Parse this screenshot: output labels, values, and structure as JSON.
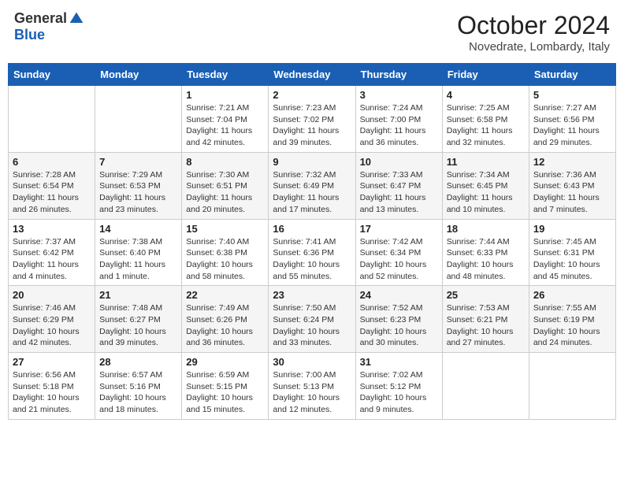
{
  "header": {
    "logo_general": "General",
    "logo_blue": "Blue",
    "month_title": "October 2024",
    "location": "Novedrate, Lombardy, Italy"
  },
  "columns": [
    "Sunday",
    "Monday",
    "Tuesday",
    "Wednesday",
    "Thursday",
    "Friday",
    "Saturday"
  ],
  "weeks": [
    [
      {
        "day": "",
        "sunrise": "",
        "sunset": "",
        "daylight": ""
      },
      {
        "day": "",
        "sunrise": "",
        "sunset": "",
        "daylight": ""
      },
      {
        "day": "1",
        "sunrise": "Sunrise: 7:21 AM",
        "sunset": "Sunset: 7:04 PM",
        "daylight": "Daylight: 11 hours and 42 minutes."
      },
      {
        "day": "2",
        "sunrise": "Sunrise: 7:23 AM",
        "sunset": "Sunset: 7:02 PM",
        "daylight": "Daylight: 11 hours and 39 minutes."
      },
      {
        "day": "3",
        "sunrise": "Sunrise: 7:24 AM",
        "sunset": "Sunset: 7:00 PM",
        "daylight": "Daylight: 11 hours and 36 minutes."
      },
      {
        "day": "4",
        "sunrise": "Sunrise: 7:25 AM",
        "sunset": "Sunset: 6:58 PM",
        "daylight": "Daylight: 11 hours and 32 minutes."
      },
      {
        "day": "5",
        "sunrise": "Sunrise: 7:27 AM",
        "sunset": "Sunset: 6:56 PM",
        "daylight": "Daylight: 11 hours and 29 minutes."
      }
    ],
    [
      {
        "day": "6",
        "sunrise": "Sunrise: 7:28 AM",
        "sunset": "Sunset: 6:54 PM",
        "daylight": "Daylight: 11 hours and 26 minutes."
      },
      {
        "day": "7",
        "sunrise": "Sunrise: 7:29 AM",
        "sunset": "Sunset: 6:53 PM",
        "daylight": "Daylight: 11 hours and 23 minutes."
      },
      {
        "day": "8",
        "sunrise": "Sunrise: 7:30 AM",
        "sunset": "Sunset: 6:51 PM",
        "daylight": "Daylight: 11 hours and 20 minutes."
      },
      {
        "day": "9",
        "sunrise": "Sunrise: 7:32 AM",
        "sunset": "Sunset: 6:49 PM",
        "daylight": "Daylight: 11 hours and 17 minutes."
      },
      {
        "day": "10",
        "sunrise": "Sunrise: 7:33 AM",
        "sunset": "Sunset: 6:47 PM",
        "daylight": "Daylight: 11 hours and 13 minutes."
      },
      {
        "day": "11",
        "sunrise": "Sunrise: 7:34 AM",
        "sunset": "Sunset: 6:45 PM",
        "daylight": "Daylight: 11 hours and 10 minutes."
      },
      {
        "day": "12",
        "sunrise": "Sunrise: 7:36 AM",
        "sunset": "Sunset: 6:43 PM",
        "daylight": "Daylight: 11 hours and 7 minutes."
      }
    ],
    [
      {
        "day": "13",
        "sunrise": "Sunrise: 7:37 AM",
        "sunset": "Sunset: 6:42 PM",
        "daylight": "Daylight: 11 hours and 4 minutes."
      },
      {
        "day": "14",
        "sunrise": "Sunrise: 7:38 AM",
        "sunset": "Sunset: 6:40 PM",
        "daylight": "Daylight: 11 hours and 1 minute."
      },
      {
        "day": "15",
        "sunrise": "Sunrise: 7:40 AM",
        "sunset": "Sunset: 6:38 PM",
        "daylight": "Daylight: 10 hours and 58 minutes."
      },
      {
        "day": "16",
        "sunrise": "Sunrise: 7:41 AM",
        "sunset": "Sunset: 6:36 PM",
        "daylight": "Daylight: 10 hours and 55 minutes."
      },
      {
        "day": "17",
        "sunrise": "Sunrise: 7:42 AM",
        "sunset": "Sunset: 6:34 PM",
        "daylight": "Daylight: 10 hours and 52 minutes."
      },
      {
        "day": "18",
        "sunrise": "Sunrise: 7:44 AM",
        "sunset": "Sunset: 6:33 PM",
        "daylight": "Daylight: 10 hours and 48 minutes."
      },
      {
        "day": "19",
        "sunrise": "Sunrise: 7:45 AM",
        "sunset": "Sunset: 6:31 PM",
        "daylight": "Daylight: 10 hours and 45 minutes."
      }
    ],
    [
      {
        "day": "20",
        "sunrise": "Sunrise: 7:46 AM",
        "sunset": "Sunset: 6:29 PM",
        "daylight": "Daylight: 10 hours and 42 minutes."
      },
      {
        "day": "21",
        "sunrise": "Sunrise: 7:48 AM",
        "sunset": "Sunset: 6:27 PM",
        "daylight": "Daylight: 10 hours and 39 minutes."
      },
      {
        "day": "22",
        "sunrise": "Sunrise: 7:49 AM",
        "sunset": "Sunset: 6:26 PM",
        "daylight": "Daylight: 10 hours and 36 minutes."
      },
      {
        "day": "23",
        "sunrise": "Sunrise: 7:50 AM",
        "sunset": "Sunset: 6:24 PM",
        "daylight": "Daylight: 10 hours and 33 minutes."
      },
      {
        "day": "24",
        "sunrise": "Sunrise: 7:52 AM",
        "sunset": "Sunset: 6:23 PM",
        "daylight": "Daylight: 10 hours and 30 minutes."
      },
      {
        "day": "25",
        "sunrise": "Sunrise: 7:53 AM",
        "sunset": "Sunset: 6:21 PM",
        "daylight": "Daylight: 10 hours and 27 minutes."
      },
      {
        "day": "26",
        "sunrise": "Sunrise: 7:55 AM",
        "sunset": "Sunset: 6:19 PM",
        "daylight": "Daylight: 10 hours and 24 minutes."
      }
    ],
    [
      {
        "day": "27",
        "sunrise": "Sunrise: 6:56 AM",
        "sunset": "Sunset: 5:18 PM",
        "daylight": "Daylight: 10 hours and 21 minutes."
      },
      {
        "day": "28",
        "sunrise": "Sunrise: 6:57 AM",
        "sunset": "Sunset: 5:16 PM",
        "daylight": "Daylight: 10 hours and 18 minutes."
      },
      {
        "day": "29",
        "sunrise": "Sunrise: 6:59 AM",
        "sunset": "Sunset: 5:15 PM",
        "daylight": "Daylight: 10 hours and 15 minutes."
      },
      {
        "day": "30",
        "sunrise": "Sunrise: 7:00 AM",
        "sunset": "Sunset: 5:13 PM",
        "daylight": "Daylight: 10 hours and 12 minutes."
      },
      {
        "day": "31",
        "sunrise": "Sunrise: 7:02 AM",
        "sunset": "Sunset: 5:12 PM",
        "daylight": "Daylight: 10 hours and 9 minutes."
      },
      {
        "day": "",
        "sunrise": "",
        "sunset": "",
        "daylight": ""
      },
      {
        "day": "",
        "sunrise": "",
        "sunset": "",
        "daylight": ""
      }
    ]
  ]
}
